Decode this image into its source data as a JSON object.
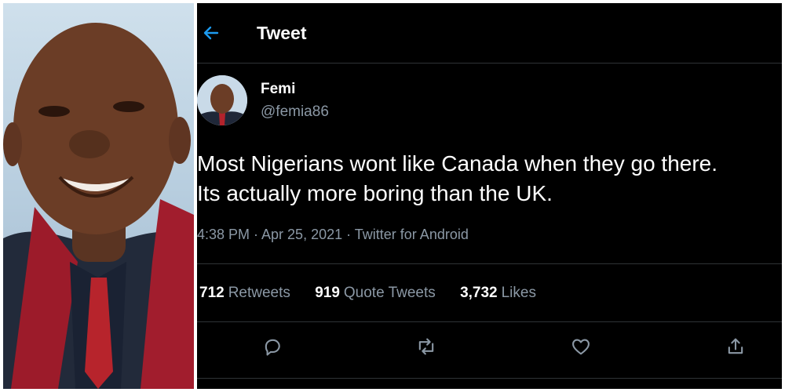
{
  "header": {
    "title": "Tweet"
  },
  "tweet": {
    "author_name": "Femi",
    "author_handle": "@femia86",
    "text_line1": "Most Nigerians wont like Canada when they go there.",
    "text_line2": "Its actually more boring than the UK.",
    "meta": "4:38 PM · Apr 25, 2021 · Twitter for Android"
  },
  "stats": {
    "retweets_count": "712",
    "retweets_label": "Retweets",
    "quote_count": "919",
    "quote_label": "Quote Tweets",
    "likes_count": "3,732",
    "likes_label": "Likes"
  },
  "icons": {
    "back": "arrow-left-icon",
    "reply": "reply-icon",
    "retweet": "retweet-icon",
    "like": "heart-icon",
    "share": "share-icon"
  },
  "colors": {
    "accent": "#1d9bf0",
    "background": "#000000",
    "muted": "#8b98a5"
  }
}
